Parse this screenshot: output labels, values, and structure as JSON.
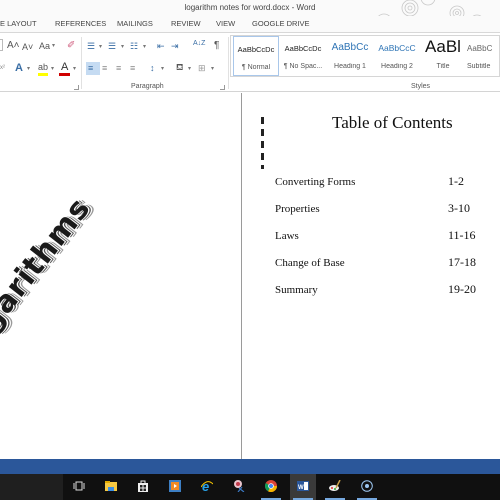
{
  "window": {
    "title": "logarithm notes for word.docx - Word"
  },
  "ribbon_tabs": [
    "E LAYOUT",
    "REFERENCES",
    "MAILINGS",
    "REVIEW",
    "VIEW",
    "GOOGLE DRIVE"
  ],
  "ribbon": {
    "font_group": {
      "grow_font": "A˄",
      "shrink_font": "A˅",
      "change_case": "Aa",
      "text_effects": "A",
      "highlight": "ab",
      "font_color": "A",
      "highlight_color": "#ffff00",
      "font_color_value": "#d00000"
    },
    "paragraph_group": {
      "label": "Paragraph",
      "show_marks": "¶",
      "sort": "A↓Z"
    },
    "styles_group": {
      "label": "Styles",
      "items": [
        {
          "preview": "AaBbCcDc",
          "name": "¶ Normal",
          "selected": true
        },
        {
          "preview": "AaBbCcDc",
          "name": "¶ No Spac...",
          "selected": false
        },
        {
          "preview": "AaBbCc",
          "name": "Heading 1",
          "selected": false
        },
        {
          "preview": "AaBbCcC",
          "name": "Heading 2",
          "selected": false
        },
        {
          "preview": "AaBl",
          "name": "Title",
          "selected": false
        },
        {
          "preview": "AaBbC",
          "name": "Subtitle",
          "selected": false
        }
      ]
    }
  },
  "document": {
    "wordart": "Logarithms",
    "toc": {
      "title": "Table of Contents",
      "entries": [
        {
          "label": "Converting Forms",
          "pages": "1-2"
        },
        {
          "label": "Properties",
          "pages": "3-10"
        },
        {
          "label": "Laws",
          "pages": "11-16"
        },
        {
          "label": "Change of Base",
          "pages": "17-18"
        },
        {
          "label": "Summary",
          "pages": "19-20"
        }
      ]
    }
  },
  "taskbar": {
    "items": [
      {
        "name": "task-view",
        "active": false,
        "open": false
      },
      {
        "name": "file-explorer",
        "active": false,
        "open": false
      },
      {
        "name": "store",
        "active": false,
        "open": false
      },
      {
        "name": "media-player",
        "active": false,
        "open": false
      },
      {
        "name": "internet-explorer",
        "active": false,
        "open": false
      },
      {
        "name": "snipping-tool",
        "active": false,
        "open": false
      },
      {
        "name": "chrome",
        "active": false,
        "open": true
      },
      {
        "name": "word",
        "active": true,
        "open": true
      },
      {
        "name": "paint-app",
        "active": false,
        "open": true
      },
      {
        "name": "record-app",
        "active": false,
        "open": true
      }
    ]
  },
  "colors": {
    "word_blue": "#2b579a",
    "taskbar": "#101010",
    "accent_underline": "#76a9e0"
  }
}
